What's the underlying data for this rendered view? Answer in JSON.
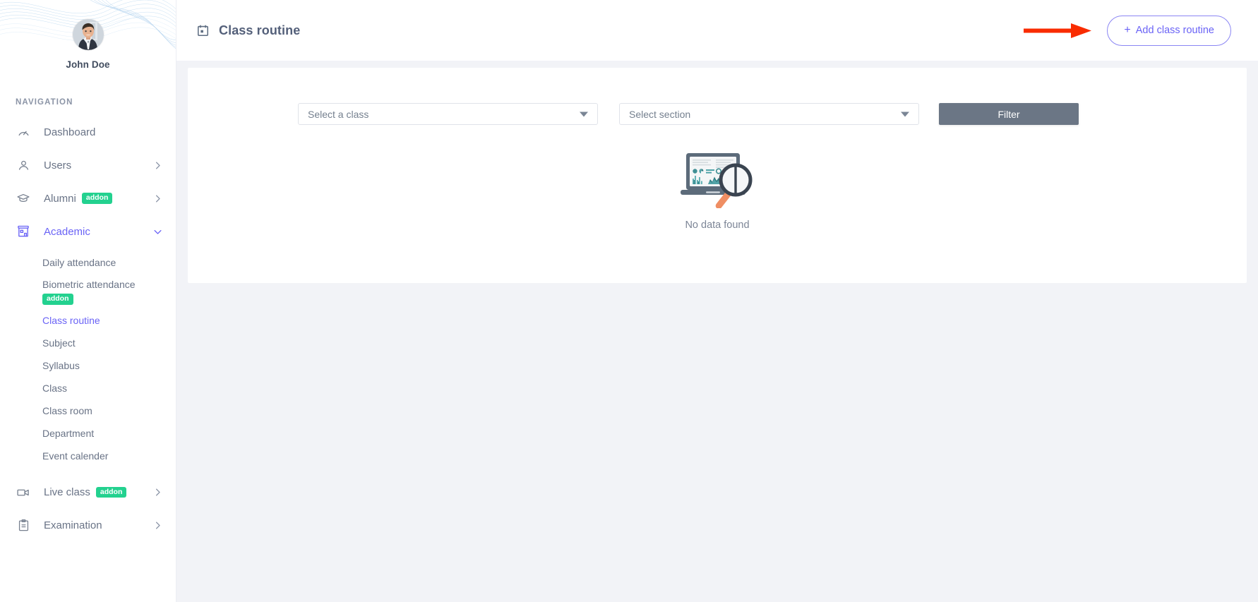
{
  "sidebar": {
    "profile": {
      "name": "John Doe",
      "avatar_icon": "user-avatar-photo"
    },
    "nav_label": "NAVIGATION",
    "items": [
      {
        "label": "Dashboard",
        "icon": "speedometer-icon",
        "badge": "",
        "chevron": ""
      },
      {
        "label": "Users",
        "icon": "user-icon",
        "badge": "",
        "chevron": "chevron-right-icon"
      },
      {
        "label": "Alumni",
        "icon": "graduation-cap-icon",
        "badge": "addon",
        "chevron": "chevron-right-icon"
      },
      {
        "label": "Academic",
        "icon": "school-building-icon",
        "badge": "",
        "chevron": "chevron-down-icon"
      },
      {
        "label": "Live class",
        "icon": "video-camera-icon",
        "badge": "addon",
        "chevron": "chevron-right-icon"
      },
      {
        "label": "Examination",
        "icon": "clipboard-icon",
        "badge": "",
        "chevron": "chevron-right-icon"
      }
    ],
    "academic_submenu": [
      {
        "label": "Daily attendance",
        "badge": ""
      },
      {
        "label": "Biometric attendance",
        "badge": "addon"
      },
      {
        "label": "Class routine",
        "badge": ""
      },
      {
        "label": "Subject",
        "badge": ""
      },
      {
        "label": "Syllabus",
        "badge": ""
      },
      {
        "label": "Class",
        "badge": ""
      },
      {
        "label": "Class room",
        "badge": ""
      },
      {
        "label": "Department",
        "badge": ""
      },
      {
        "label": "Event calender",
        "badge": ""
      }
    ],
    "active_item": "Academic",
    "active_subitem": "Class routine"
  },
  "header": {
    "title": "Class routine",
    "title_icon": "calendar-icon",
    "add_button_label": "Add class routine",
    "add_button_plus": "+",
    "annotation_arrow": "red-arrow-pointing-right"
  },
  "filters": {
    "class_select": {
      "value": "Select a class",
      "caret_icon": "caret-down-icon"
    },
    "section_select": {
      "value": "Select section",
      "caret_icon": "caret-down-icon"
    },
    "filter_button_label": "Filter"
  },
  "empty_state": {
    "text": "No data found",
    "illustration": "laptop-with-magnifier-no-data-illustration"
  },
  "colors": {
    "accent": "#6a63f6",
    "addon_badge": "#23d18f",
    "filter_button": "#6b7685",
    "annotation_red": "#f92c00",
    "page_bg": "#f2f3f7",
    "text_muted": "#697386"
  }
}
